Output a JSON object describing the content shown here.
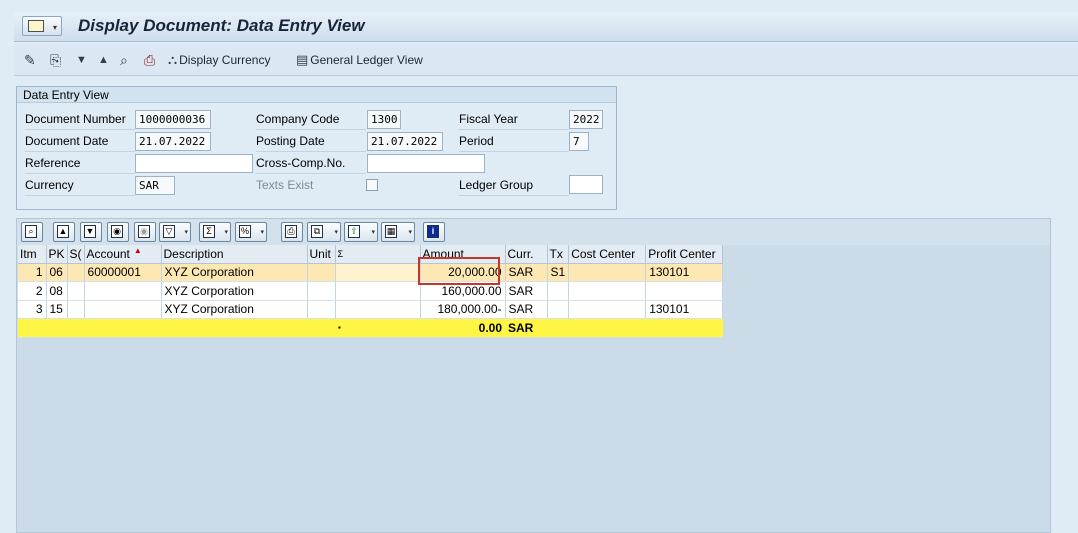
{
  "window": {
    "title": "Display Document: Data Entry View"
  },
  "toolbar": {
    "display_currency": "Display Currency",
    "general_ledger_view": "General Ledger View"
  },
  "header": {
    "group_title": "Data Entry View",
    "document_number_label": "Document Number",
    "document_number": "1000000036",
    "company_code_label": "Company Code",
    "company_code": "1300",
    "fiscal_year_label": "Fiscal Year",
    "fiscal_year": "2022",
    "document_date_label": "Document Date",
    "document_date": "21.07.2022",
    "posting_date_label": "Posting Date",
    "posting_date": "21.07.2022",
    "period_label": "Period",
    "period": "7",
    "reference_label": "Reference",
    "reference": "",
    "cross_comp_label": "Cross-Comp.No.",
    "cross_comp": "",
    "currency_label": "Currency",
    "currency": "SAR",
    "texts_exist_label": "Texts Exist",
    "ledger_group_label": "Ledger Group",
    "ledger_group": ""
  },
  "grid": {
    "columns": [
      "Itm",
      "PK",
      "S(",
      "Account",
      "Description",
      "Unit",
      "Σ",
      "Amount",
      "Curr.",
      "Tx",
      "Cost Center",
      "Profit Center"
    ],
    "rows": [
      {
        "itm": "1",
        "pk": "06",
        "s": "",
        "account": "60000001",
        "description": "XYZ Corporation",
        "unit": "",
        "amount": "20,000.00",
        "curr": "SAR",
        "tx": "S1",
        "cost_center": "",
        "profit_center": "130101"
      },
      {
        "itm": "2",
        "pk": "08",
        "s": "",
        "account": "",
        "description": "XYZ Corporation",
        "unit": "",
        "amount": "160,000.00",
        "curr": "SAR",
        "tx": "",
        "cost_center": "",
        "profit_center": ""
      },
      {
        "itm": "3",
        "pk": "15",
        "s": "",
        "account": "",
        "description": "XYZ Corporation",
        "unit": "",
        "amount": "180,000.00-",
        "curr": "SAR",
        "tx": "",
        "cost_center": "",
        "profit_center": "130101"
      }
    ],
    "total": {
      "marker": "▪",
      "amount": "0.00",
      "curr": "SAR"
    }
  },
  "colors": {
    "highlight_box": "#c0392b",
    "selected_row": "#fde8b4",
    "total_row": "#fff544"
  }
}
